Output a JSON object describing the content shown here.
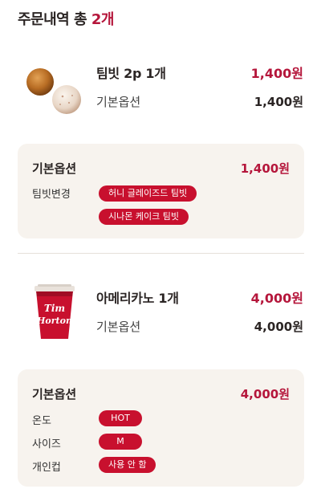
{
  "header": {
    "prefix": "주문내역 총 ",
    "count": "2개"
  },
  "items": [
    {
      "name": "팀빗 2p 1개",
      "price": "1,400원",
      "sub_label": "기본옵션",
      "sub_price": "1,400원",
      "options_card": {
        "title": "기본옵션",
        "price": "1,400원",
        "rows": [
          {
            "label": "팀빗변경",
            "values": [
              "허니 글레이즈드 팀빗",
              "시나몬 케이크 팀빗"
            ]
          }
        ]
      }
    },
    {
      "name": "아메리카노 1개",
      "price": "4,000원",
      "sub_label": "기본옵션",
      "sub_price": "4,000원",
      "options_card": {
        "title": "기본옵션",
        "price": "4,000원",
        "rows": [
          {
            "label": "온도",
            "values": [
              "HOT"
            ]
          },
          {
            "label": "사이즈",
            "values": [
              "M"
            ]
          },
          {
            "label": "개인컵",
            "values": [
              "사용 안 함"
            ]
          }
        ]
      }
    }
  ],
  "colors": {
    "accent": "#c8102e",
    "accent_text": "#b5163b",
    "card_bg": "#f7f3ee"
  }
}
